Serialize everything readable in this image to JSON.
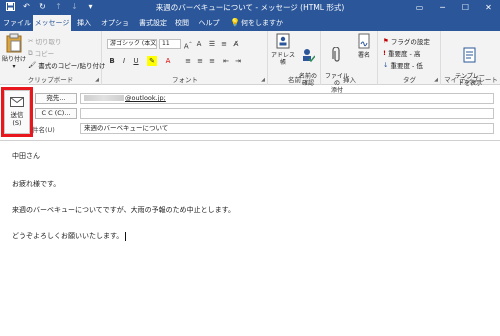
{
  "window": {
    "title": "来週のバーベキューについて - メッセージ (HTML 形式)",
    "controls": [
      "restore",
      "minimize",
      "maximize",
      "close"
    ]
  },
  "tabs": {
    "file": "ファイル",
    "message": "メッセージ",
    "insert": "挿入",
    "options": "オプション",
    "format_text": "書式設定",
    "review": "校閲",
    "help": "ヘルプ",
    "tell_me": "何をしますか"
  },
  "ribbon": {
    "clipboard": {
      "label": "クリップボード",
      "paste": "貼り付け",
      "cut": "切り取り",
      "copy": "コピー",
      "format_painter": "書式のコピー/貼り付け"
    },
    "font": {
      "label": "フォント",
      "font_name": "游ゴシック (本文",
      "font_size": "11"
    },
    "names": {
      "label": "名前",
      "address_book": "アドレス帳",
      "check_names": "名前の\n確認"
    },
    "include": {
      "label": "挿入",
      "attach_file": "ファイルの\n添付",
      "signature": "署名"
    },
    "tags": {
      "label": "タグ",
      "follow_up": "フラグの設定",
      "high_importance": "重要度 - 高",
      "low_importance": "重要度 - 低"
    },
    "templates": {
      "label": "マイ テンプレート",
      "view_templates": "テンプレー\nトを表示"
    }
  },
  "compose": {
    "send_button": "送信\n(S)",
    "to_button": "宛先...",
    "cc_button": "C C (C)...",
    "subject_label": "件名(U)",
    "to_value": "@outlook.jp;",
    "cc_value": "",
    "subject_value": "来週のバーベキューについて"
  },
  "body": {
    "lines": [
      "中田さん",
      "お疲れ様です。",
      "来週のバーベキューについてですが、大雨の予報のため中止とします。",
      "どうぞよろしくお願いいたします。"
    ]
  },
  "colors": {
    "titlebar": "#2b579a",
    "ribbon": "#f3f3f3",
    "highlight": "#e8161d"
  }
}
